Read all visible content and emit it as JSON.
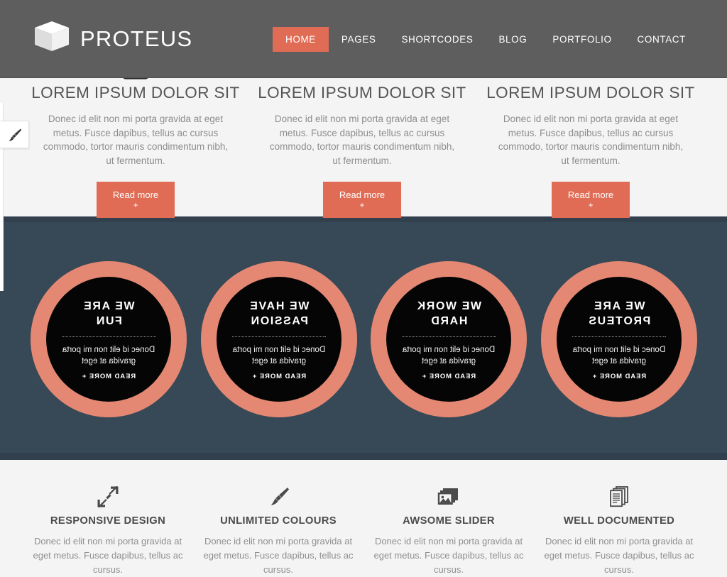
{
  "header": {
    "logo_text": "PROTEUS",
    "logo_icon": "cube-icon",
    "nav": [
      {
        "label": "HOME",
        "active": true
      },
      {
        "label": "PAGES",
        "active": false
      },
      {
        "label": "SHORTCODES",
        "active": false
      },
      {
        "label": "BLOG",
        "active": false
      },
      {
        "label": "PORTFOLIO",
        "active": false
      },
      {
        "label": "CONTACT",
        "active": false
      }
    ]
  },
  "style_switcher": {
    "icon": "paintbrush-icon"
  },
  "features": [
    {
      "icon": "flask-icon",
      "title": "LOREM IPSUM DOLOR SIT",
      "text": "Donec id elit non mi porta gravida at eget metus. Fusce dapibus, tellus ac cursus commodo, tortor mauris condimentum nibh, ut fermentum.",
      "button_label": "Read more",
      "button_plus": "+"
    },
    {
      "icon": "tablet-icon",
      "title": "LOREM IPSUM DOLOR SIT",
      "text": "Donec id elit non mi porta gravida at eget metus. Fusce dapibus, tellus ac cursus commodo, tortor mauris condimentum nibh, ut fermentum.",
      "button_label": "Read more",
      "button_plus": "+"
    },
    {
      "icon": "paintbrush-icon",
      "title": "LOREM IPSUM DOLOR SIT",
      "text": "Donec id elit non mi porta gravida at eget metus. Fusce dapibus, tellus ac cursus commodo, tortor mauris condimentum nibh, ut fermentum.",
      "button_label": "Read more",
      "button_plus": "+"
    }
  ],
  "circles": [
    {
      "title_line1": "WE ARE",
      "title_line2": "FUN",
      "text_line1": "Donec id elit non mi porta",
      "text_line2": "gravida at eget",
      "link_label": "READ MORE +"
    },
    {
      "title_line1": "WE HAVE",
      "title_line2": "PASSION",
      "text_line1": "Donec id elit non mi porta",
      "text_line2": "gravida at eget",
      "link_label": "READ MORE +"
    },
    {
      "title_line1": "WE WORK",
      "title_line2": "HARD",
      "text_line1": "Donec id elit non mi porta",
      "text_line2": "gravida at eget",
      "link_label": "READ MORE +"
    },
    {
      "title_line1": "WE ARE",
      "title_line2": "PROTEUS",
      "text_line1": "Donec id elit non mi porta",
      "text_line2": "gravida at eget",
      "link_label": "READ MORE +"
    }
  ],
  "services": [
    {
      "icon": "resize-arrows-icon",
      "title": "RESPONSIVE DESIGN",
      "text": "Donec id elit non mi porta gravida at eget metus. Fusce dapibus, tellus ac cursus."
    },
    {
      "icon": "paintbrush-icon",
      "title": "UNLIMITED COLOURS",
      "text": "Donec id elit non mi porta gravida at eget metus. Fusce dapibus, tellus ac cursus."
    },
    {
      "icon": "image-icon",
      "title": "AWSOME SLIDER",
      "text": "Donec id elit non mi porta gravida at eget metus. Fusce dapibus, tellus ac cursus."
    },
    {
      "icon": "documents-icon",
      "title": "WELL DOCUMENTED",
      "text": "Donec id elit non mi porta gravida at eget metus. Fusce dapibus, tellus ac cursus."
    }
  ],
  "colors": {
    "accent": "#e06c55",
    "circle_ring": "#e58873",
    "dark_band": "#374957",
    "header_bg": "#5e5e5e",
    "page_bg": "#f4f4f4"
  }
}
